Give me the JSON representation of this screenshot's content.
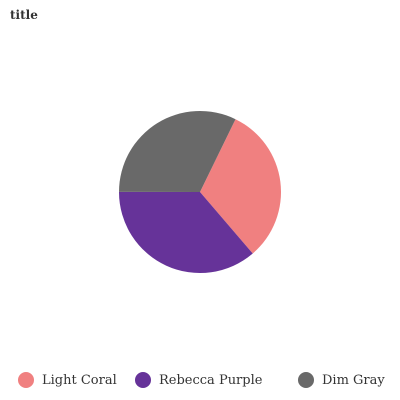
{
  "chart_data": {
    "type": "pie",
    "title": "title",
    "slices": [
      {
        "label": "Light Coral",
        "value": 31.5,
        "color": "#f08080"
      },
      {
        "label": "Rebecca Purple",
        "value": 36.3,
        "color": "#663399"
      },
      {
        "label": "Dim Gray",
        "value": 32.2,
        "color": "#696969"
      }
    ],
    "legend_position": "bottom"
  }
}
